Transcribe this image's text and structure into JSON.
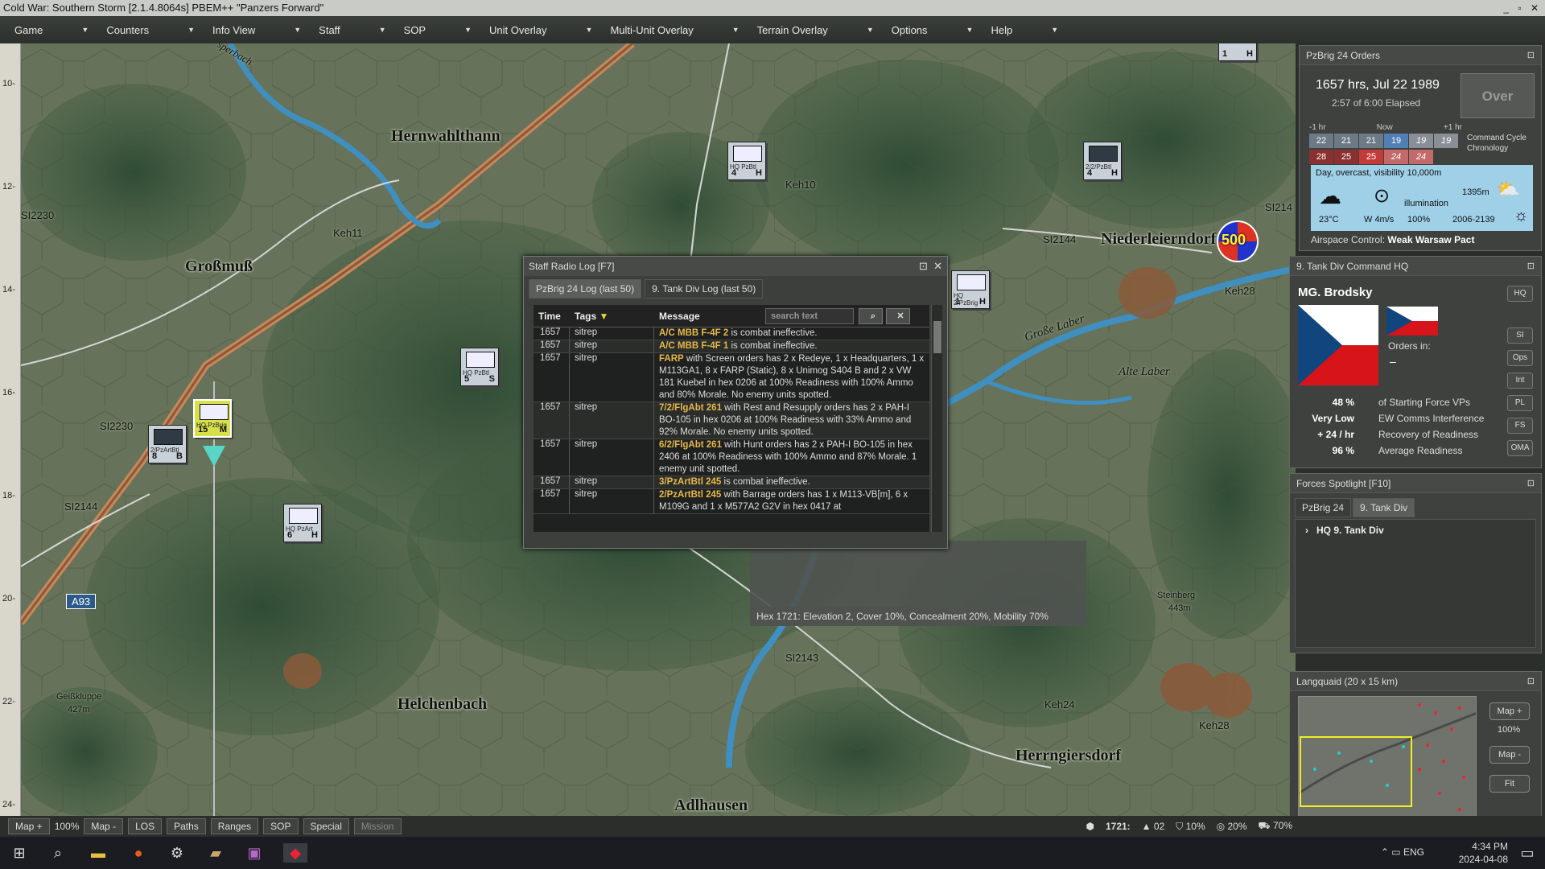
{
  "window": {
    "title": "Cold War: Southern Storm  [2.1.4.8064s]  PBEM++ \"Panzers Forward\""
  },
  "menu": [
    "Game",
    "Counters",
    "Info View",
    "Staff",
    "SOP",
    "Unit Overlay",
    "Multi-Unit Overlay",
    "Terrain Overlay",
    "Options",
    "Help"
  ],
  "ruler": [
    "10-",
    "12-",
    "14-",
    "16-",
    "18-",
    "20-",
    "22-",
    "24-"
  ],
  "map_labels": {
    "towns": [
      "Hernwahlthann",
      "Großmuß",
      "Niederleierndorf",
      "Helchenbach",
      "Herrngiersdorf",
      "Adlhausen"
    ],
    "roads": [
      "Keh10",
      "Keh11",
      "SI2230",
      "SI2230",
      "SI2144",
      "SI2144",
      "SI2143",
      "Keh28",
      "Keh24",
      "Keh28",
      "SI214",
      "A93"
    ],
    "places": [
      "Große Laber",
      "Alte Laber",
      "Steinberg",
      "443m",
      "Geißkluppe",
      "427m",
      "sperbach"
    ],
    "points": "500"
  },
  "counters": [
    {
      "name": "HQ PzBrig",
      "l": "15",
      "r": "M"
    },
    {
      "name": "2/PzArtBtl",
      "l": "8",
      "r": "B"
    },
    {
      "name": "HQ PzArt",
      "l": "6",
      "r": "H"
    },
    {
      "name": "HQ PzBtl",
      "l": "5",
      "r": "S"
    },
    {
      "name": "HQ PzBtl",
      "l": "4",
      "r": "H"
    },
    {
      "name": "2/2/PzBtl",
      "l": "4",
      "r": "H"
    },
    {
      "name": "HQ 2/PzBrig",
      "l": "1",
      "r": "H"
    },
    {
      "name": "",
      "l": "1",
      "r": "H"
    }
  ],
  "radio_log": {
    "title": "Staff Radio Log   [F7]",
    "tabs": [
      "PzBrig 24 Log (last 50)",
      "9. Tank Div Log (last 50)"
    ],
    "headers": [
      "Time",
      "Tags",
      "Message"
    ],
    "search_placeholder": "search text",
    "rows": [
      {
        "time": "1657",
        "tag": "sitrep",
        "unit": "A/C MBB F-4F 2",
        "text": " is combat ineffective."
      },
      {
        "time": "1657",
        "tag": "sitrep",
        "unit": "A/C MBB F-4F 1",
        "text": " is combat ineffective."
      },
      {
        "time": "1657",
        "tag": "sitrep",
        "unit": "FARP",
        "text": " with Screen orders has 2 x Redeye, 1 x Headquarters, 1 x M113GA1, 8 x FARP (Static), 8 x Unimog S404 B and 2 x VW 181 Kuebel in hex 0206 at 100% Readiness with 100% Ammo and 80% Morale. No enemy units spotted."
      },
      {
        "time": "1657",
        "tag": "sitrep",
        "unit": "7/2/FlgAbt 261",
        "text": " with Rest and Resupply orders has 2 x PAH-I BO-105 in hex 0206 at 100% Readiness with 33% Ammo and 92% Morale. No enemy units spotted."
      },
      {
        "time": "1657",
        "tag": "sitrep",
        "unit": "6/2/FlgAbt 261",
        "text": " with Hunt orders has 2 x PAH-I BO-105 in hex 2406 at 100% Readiness with 100% Ammo and 87% Morale. 1 enemy unit spotted."
      },
      {
        "time": "1657",
        "tag": "sitrep",
        "unit": "3/PzArtBtl 245",
        "text": " is combat ineffective."
      },
      {
        "time": "1657",
        "tag": "sitrep",
        "unit": "2/PzArtBtl 245",
        "text": " with Barrage orders has 1 x M113-VB[m], 6 x M109G and 1 x M577A2 G2V in hex 0417 at"
      }
    ]
  },
  "hex_info": "Hex 1721: Elevation 2, Cover 10%, Concealment 20%, Mobility 70%",
  "orders": {
    "title": "PzBrig 24 Orders",
    "datetime": "1657 hrs, Jul 22 1989",
    "elapsed": "2:57 of 6:00 Elapsed",
    "over": "Over",
    "chrono_labels": [
      "-1 hr",
      "Now",
      "+1 hr"
    ],
    "row1": [
      "22",
      "21",
      "21",
      "19",
      "19",
      "19"
    ],
    "row2": [
      "28",
      "25",
      "25",
      "24",
      "24"
    ],
    "chrono_title": "Command Cycle Chronology",
    "weather": "Day, overcast, visibility 10,000m",
    "temp": "23°C",
    "wind": "W 4m/s",
    "illum_label": "illumination",
    "illum": "100%",
    "cloud": "1395m",
    "sun": "2006-2139",
    "airspace_label": "Airspace Control:",
    "airspace": "Weak Warsaw Pact"
  },
  "command": {
    "title": "9. Tank Div Command HQ",
    "commander": "MG. Brodsky",
    "orders_in": "Orders in:",
    "orders_val": "–",
    "buttons": [
      "HQ",
      "SI",
      "Ops",
      "Int",
      "PL",
      "FS",
      "OMA"
    ],
    "stats": [
      {
        "v": "48 %",
        "l": "of Starting Force VPs"
      },
      {
        "v": "Very Low",
        "l": "EW Comms Interference"
      },
      {
        "v": "+ 24 / hr",
        "l": "Recovery of Readiness"
      },
      {
        "v": "96 %",
        "l": "Average Readiness"
      }
    ]
  },
  "spotlight": {
    "title": "Forces Spotlight   [F10]",
    "tabs": [
      "PzBrig 24",
      "9. Tank Div"
    ],
    "item": "HQ 9. Tank Div"
  },
  "minimap": {
    "title": "Langquaid (20 x 15 km)",
    "map_plus": "Map +",
    "zoom": "100%",
    "map_minus": "Map -",
    "fit": "Fit"
  },
  "bottom": {
    "buttons": [
      "Map +",
      "100%",
      "Map -",
      "LOS",
      "Paths",
      "Ranges",
      "SOP",
      "Special",
      "Mission"
    ],
    "hex": "1721:",
    "elev": "02",
    "cover": "10%",
    "conceal": "20%",
    "mobility": "70%"
  },
  "taskbar": {
    "lang": "ENG",
    "time": "4:34 PM",
    "date": "2024-04-08"
  },
  "colors": {
    "flag_red": "#d7141a",
    "flag_blue": "#11457e",
    "selected": "#d5e04a",
    "highlight": "#e6b94a"
  }
}
